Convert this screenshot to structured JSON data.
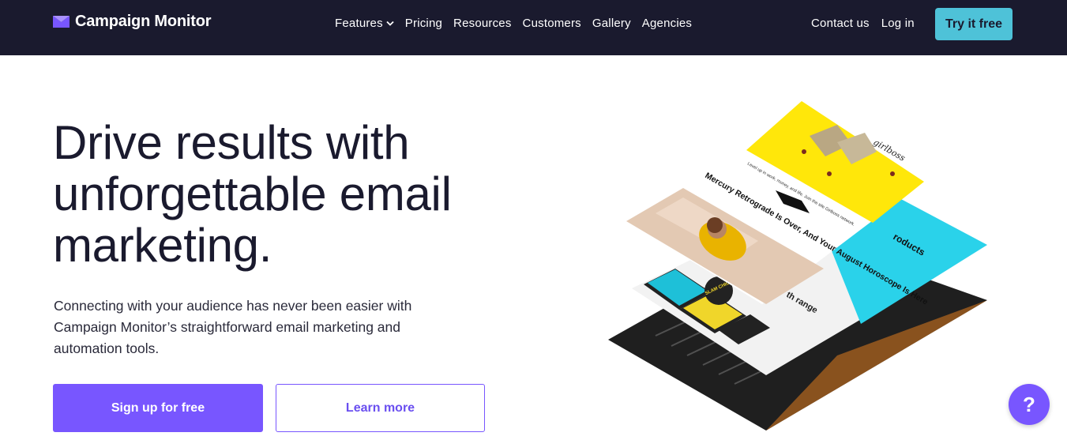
{
  "brand": {
    "name": "Campaign Monitor",
    "color": "#7856ff",
    "nav_bg": "#1a1a2e",
    "accent": "#4ec2d8"
  },
  "nav": {
    "features": "Features",
    "pricing": "Pricing",
    "resources": "Resources",
    "customers": "Customers",
    "gallery": "Gallery",
    "agencies": "Agencies",
    "contact": "Contact us",
    "login": "Log in",
    "try": "Try it free"
  },
  "hero": {
    "title": "Drive results with unforgettable email marketing.",
    "subtitle": "Connecting with your audience has never been easier with Campaign Monitor’s straightforward email marketing and automation tools.",
    "primary_cta": "Sign up for free",
    "secondary_cta": "Learn more"
  },
  "illustration": {
    "brand_label": "girlboss",
    "headline": "Mercury Retrograde Is Over, And Your August Horoscope Is Here",
    "teaser": "Level up in work, money, and life. Join the site Girlboss network.",
    "products_label": "roducts",
    "range_label": "th range",
    "food_label": "SLAM CHICKEN"
  },
  "help": {
    "icon": "question-icon",
    "label": "?"
  }
}
